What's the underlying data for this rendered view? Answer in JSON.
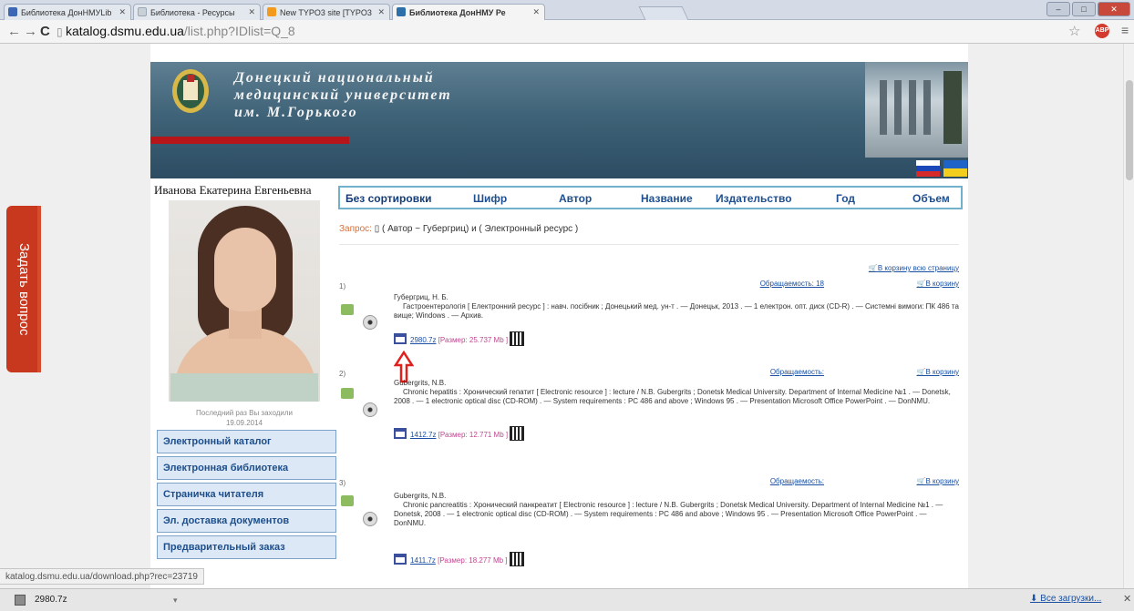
{
  "browser": {
    "tabs": [
      {
        "label": "Библиотека ДонНМУLib",
        "icon": "library-icon",
        "color": "#3b67b5"
      },
      {
        "label": "Библиотека - Ресурсы",
        "icon": "page-icon",
        "color": "#9aa6b4"
      },
      {
        "label": "New TYPO3 site [TYPO3",
        "icon": "typo3-icon",
        "color": "#f39a1e"
      },
      {
        "label": "Библиотека ДонНМУ Ре",
        "icon": "library-icon",
        "color": "#2d6fa8",
        "active": true
      }
    ],
    "url_host": "katalog.dsmu.edu.ua",
    "url_path": "/list.php?IDlist=Q_8",
    "window_controls": [
      "–",
      "□",
      "✕"
    ]
  },
  "side_tab": {
    "label": "Задать вопрос"
  },
  "header": {
    "title_lines": [
      "Донецкий национальный",
      "медицинский университет",
      "им. М.Горького"
    ],
    "flags": [
      "ru-flag-icon",
      "ua-flag-icon"
    ]
  },
  "user": {
    "name": "Иванова Екатерина Евгеньевна",
    "last_visit_label": "Последний раз Вы заходили",
    "last_visit_date": "19.09.2014"
  },
  "menu": [
    "Электронный каталог",
    "Электронная библиотека",
    "Страничка читателя",
    "Эл. доставка документов",
    "Предварительный заказ"
  ],
  "sort": {
    "options": [
      "Без сортировки",
      "Шифр",
      "Автор",
      "Название",
      "Издательство",
      "Год",
      "Объем"
    ]
  },
  "query": {
    "label": "Запрос:",
    "text": "( Автор ~ Губергриц) и ( Электронный ресурс )"
  },
  "cart_all_label": "В корзину всю страницу",
  "records": [
    {
      "num": "1)",
      "citation": "Обращаемость: 18",
      "cart": "В корзину",
      "author": "Губергриц, Н. Б.",
      "text": "Гастроентерологія [ Електронний ресурс ] : навч. посібник ; Донецький мед. ун-т . — Донецьк, 2013 . — 1 електрон. опт. диск (CD-R) . — Системні вимоги: ПК 486 та вище; Windows . — Архив.",
      "size": "2980.7z",
      "meta": "[Размер: 25.737 Мb ]"
    },
    {
      "num": "2)",
      "citation": "Обращаемость:",
      "cart": "В корзину",
      "author": "Gubergrits, N.B.",
      "text": "Chronic hepatitis : Хронический гепатит [ Electronic resource ] : lecture / N.B. Gubergrits ; Donetsk Medical University. Department of Internal Medicine №1 . — Donetsk, 2008 . — 1 electronic optical disc (CD-ROM) . — System requirements : PC 486 and above ; Windows 95 . — Presentation Microsoft Office PowerPoint . — DonNMU.",
      "size": "1412.7z",
      "meta": "[Размер: 12.771 Мb ]"
    },
    {
      "num": "3)",
      "citation": "Обращаемость:",
      "cart": "В корзину",
      "author": "Gubergrits, N.B.",
      "text": "Chronic pancreatitis : Хронический панкреатит [ Electronic resource ] : lecture / N.B. Gubergrits ; Donetsk Medical University. Department of Internal Medicine №1 . — Donetsk, 2008 . — 1 electronic optical disc (CD-ROM) . — System requirements : PC 486 and above ; Windows 95 . — Presentation Microsoft Office PowerPoint . — DonNMU.",
      "size": "1411.7z",
      "meta": "[Размер: 18.277 Мb ]"
    }
  ],
  "status_url": "katalog.dsmu.edu.ua/download.php?rec=23719",
  "downloads": {
    "file": "2980.7z",
    "all_label": "Все загрузки..."
  }
}
